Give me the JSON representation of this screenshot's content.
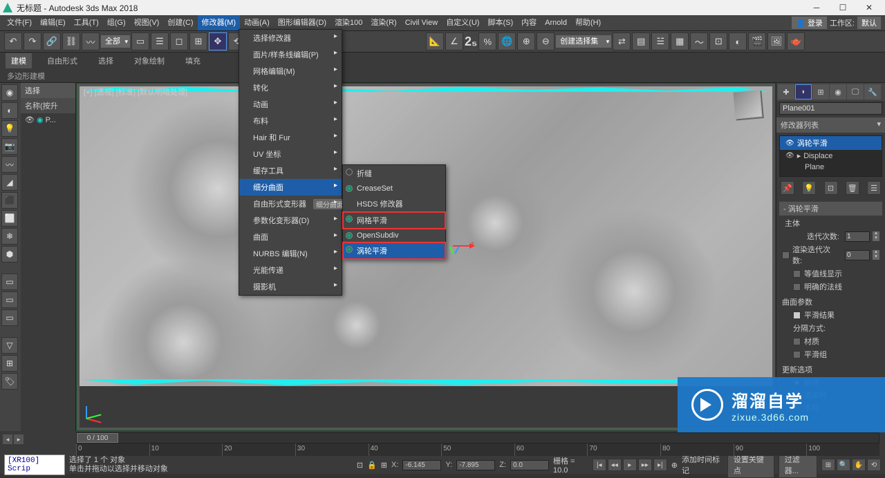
{
  "titlebar": {
    "text": "无标题 - Autodesk 3ds Max 2018"
  },
  "menubar": {
    "items": [
      "文件(F)",
      "编辑(E)",
      "工具(T)",
      "组(G)",
      "视图(V)",
      "创建(C)",
      "修改器(M)",
      "动画(A)",
      "图形编辑器(D)",
      "渲染100",
      "渲染(R)",
      "Civil View",
      "自定义(U)",
      "脚本(S)",
      "内容",
      "Arnold",
      "帮助(H)"
    ],
    "open_index": 6,
    "login": "登录",
    "workspace_label": "工作区:",
    "workspace_value": "默认"
  },
  "toolbar": {
    "all_combo": "全部",
    "create_sel_set": "创建选择集"
  },
  "ribbon": {
    "tabs": [
      "建模",
      "自由形式",
      "选择",
      "对象绘制",
      "填充"
    ],
    "active_index": 0,
    "subtitle": "多边形建模"
  },
  "scene_explorer": {
    "title": "选择",
    "col_header": "名称(按升",
    "row0": "P..."
  },
  "viewport": {
    "label": "[+] [透视] [标准] [默认明暗处理]"
  },
  "dropdown1": {
    "items": [
      {
        "label": "选择修改器",
        "sub": true
      },
      {
        "label": "面片/样条线编辑(P)",
        "sub": true
      },
      {
        "label": "网格编辑(M)",
        "sub": true
      },
      {
        "label": "转化",
        "sub": true
      },
      {
        "label": "动画",
        "sub": true
      },
      {
        "label": "布料",
        "sub": true
      },
      {
        "label": "Hair 和 Fur",
        "sub": true
      },
      {
        "label": "UV 坐标",
        "sub": true
      },
      {
        "label": "缓存工具",
        "sub": true
      },
      {
        "label": "细分曲面",
        "sub": true,
        "highlight": true,
        "hint": ""
      },
      {
        "label": "自由形式变形器",
        "sub": true,
        "hint": "细分曲面"
      },
      {
        "label": "参数化变形器(D)",
        "sub": true
      },
      {
        "label": "曲面",
        "sub": true
      },
      {
        "label": "NURBS 编辑(N)",
        "sub": true
      },
      {
        "label": "光能传递",
        "sub": true
      },
      {
        "label": "摄影机",
        "sub": true
      }
    ]
  },
  "dropdown2": {
    "items": [
      {
        "label": "折缝",
        "icon": true
      },
      {
        "label": "CreaseSet",
        "icon": true
      },
      {
        "label": "HSDS 修改器"
      },
      {
        "label": "网格平滑",
        "icon": true,
        "red": true
      },
      {
        "label": "OpenSubdiv",
        "icon": true
      },
      {
        "label": "涡轮平滑",
        "icon": true,
        "highlight": true,
        "red": true
      }
    ]
  },
  "command_panel": {
    "object_name": "Plane001",
    "mod_list_header": "修改器列表",
    "stack": [
      {
        "label": "涡轮平滑",
        "selected": true,
        "eye": true
      },
      {
        "label": "Displace",
        "eye": true,
        "expand": true
      },
      {
        "label": "Plane"
      }
    ],
    "rollout1": {
      "title": "涡轮平滑",
      "main_body": "主体",
      "iter_label": "迭代次数:",
      "iter_val": "1",
      "render_iter_label": "渲染迭代次数:",
      "render_iter_val": "0",
      "isoline": "等值线显示",
      "explicit_normals": "明确的法线"
    },
    "rollout2": {
      "title": "曲面参数",
      "smooth_result": "平滑结果",
      "sep_by": "分隔方式:",
      "by_material": "材质",
      "by_smoothgroup": "平滑组"
    },
    "rollout3": {
      "title": "更新选项",
      "always": "始终",
      "on_render": "渲染时",
      "manual": "手动"
    }
  },
  "timeline": {
    "slider_text": "0 / 100",
    "ticks": [
      "0",
      "10",
      "20",
      "30",
      "40",
      "50",
      "60",
      "70",
      "80",
      "90",
      "100"
    ]
  },
  "status": {
    "prompt": "[XR100] Scrip",
    "msg1": "选择了 1 个 对象",
    "msg2": "单击并拖动以选择并移动对象",
    "x_label": "X:",
    "x_val": "-6.145",
    "y_label": "Y:",
    "y_val": "-7.895",
    "z_label": "Z:",
    "z_val": "0.0",
    "grid_label": "栅格 = 10.0",
    "add_time_tag": "添加时间标记",
    "set_key": "设置关键点",
    "filter": "过滤器..."
  },
  "watermark": {
    "main": "溜溜自学",
    "sub": "zixue.3d66.com"
  }
}
